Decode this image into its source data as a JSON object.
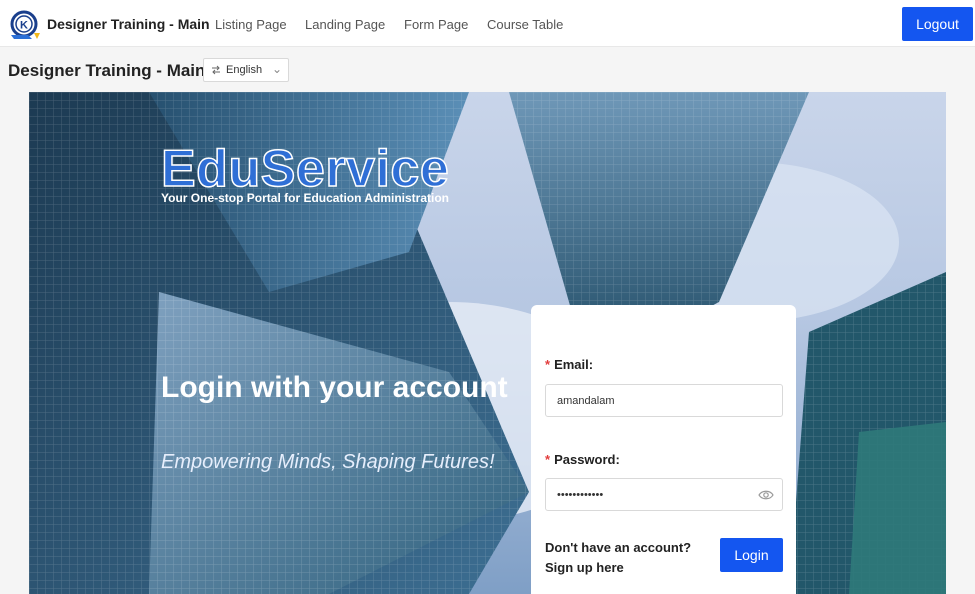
{
  "header": {
    "app_name": "Designer Training - Main",
    "nav": [
      "Listing Page",
      "Landing Page",
      "Form Page",
      "Course Table"
    ],
    "logout_label": "Logout",
    "logo_icon": "k-logo-icon"
  },
  "subheader": {
    "title": "Designer Training - Main",
    "language": "English",
    "language_icon": "swap-icon"
  },
  "hero": {
    "brand": "EduService",
    "brand_tagline": "Your One-stop Portal for Education Administration",
    "headline": "Login with your account",
    "slogan": "Empowering Minds, Shaping Futures!"
  },
  "login_form": {
    "email_label": "Email:",
    "email_value": "amandalam",
    "password_label": "Password:",
    "password_value": "••••••••••••",
    "signup_text": "Don't have an account? Sign up here",
    "login_label": "Login",
    "required_marker": "*"
  },
  "colors": {
    "primary": "#1456f0",
    "brand": "#2f6fd6",
    "required": "#e23c3c"
  }
}
